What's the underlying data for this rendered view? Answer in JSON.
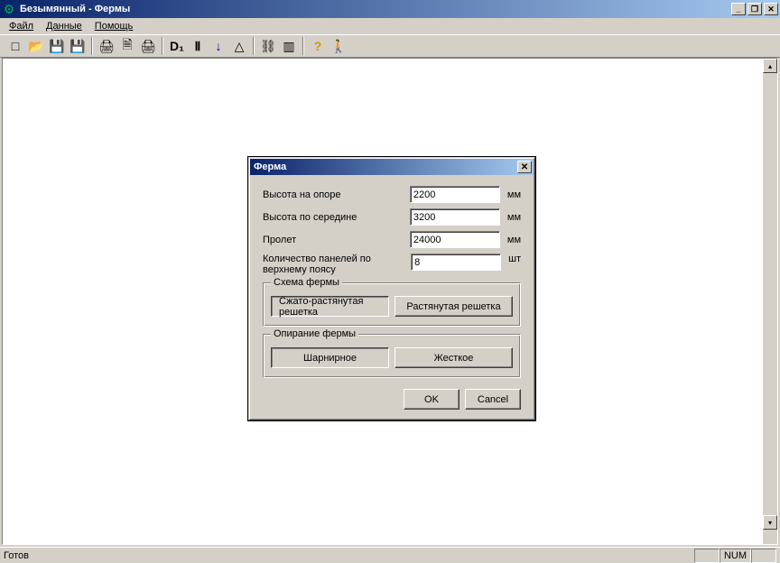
{
  "window": {
    "title": "Безымянный - Фермы",
    "minimize": "_",
    "maximize": "❐",
    "close": "✕"
  },
  "menu": {
    "file": "Файл",
    "data": "Данные",
    "help": "Помощь"
  },
  "toolbar": {
    "new": "□",
    "open": "📂",
    "save1": "💾",
    "save2": "💾",
    "print": "🖨",
    "printpre": "🗎",
    "print2": "🖨",
    "d1": "D₁",
    "h": "Ⅱ",
    "arrow": "↓",
    "tri": "△",
    "graph": "⛓",
    "chart": "▥",
    "help": "?",
    "exit": "🚶"
  },
  "scroll": {
    "up": "▴",
    "down": "▾"
  },
  "dialog": {
    "title": "Ферма",
    "close": "✕",
    "height_support_label": "Высота на опоре",
    "height_support_value": "2200",
    "height_mid_label": "Высота по середине",
    "height_mid_value": "3200",
    "span_label": "Пролет",
    "span_value": "24000",
    "panels_label": "Количество панелей по верхнему поясу",
    "panels_value": "8",
    "mm": "мм",
    "pcs": "шт",
    "scheme_title": "Схема фермы",
    "scheme_compressed": "Сжато-растянутая решетка",
    "scheme_stretched": "Растянутая решетка",
    "support_title": "Опирание фермы",
    "support_hinged": "Шарнирное",
    "support_rigid": "Жесткое",
    "ok": "OK",
    "cancel": "Cancel"
  },
  "status": {
    "ready": "Готов",
    "num": "NUM"
  }
}
